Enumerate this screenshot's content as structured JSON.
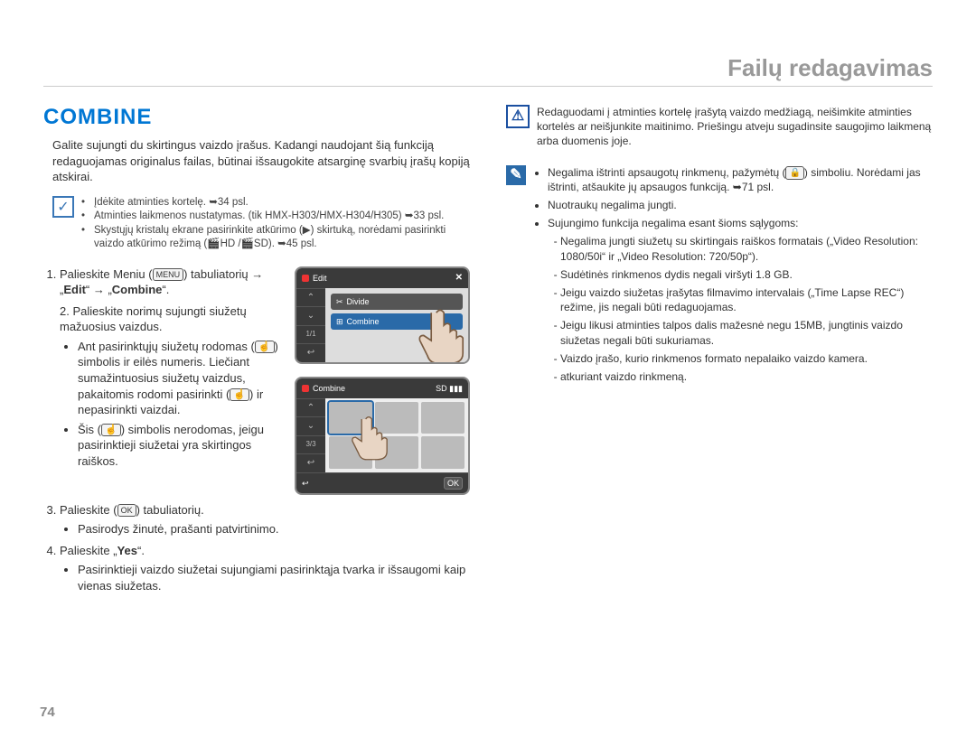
{
  "header": {
    "title": "Failų redagavimas"
  },
  "page_number": "74",
  "left": {
    "section_title": "COMBINE",
    "intro": "Galite sujungti du skirtingus vaizdo įrašus. Kadangi naudojant šią funkciją redaguojamas originalus failas, būtinai išsaugokite atsarginę svarbių įrašų kopiją atskirai.",
    "prereq": {
      "items": [
        "Įdėkite atminties kortelę. ➥34 psl.",
        "Atminties laikmenos nustatymas. (tik HMX-H303/HMX-H304/H305) ➥33 psl.",
        "Skystųjų kristalų ekrane pasirinkite atkūrimo (▶) skirtuką, norėdami pasirinkti vaizdo atkūrimo režimą (🎬HD /🎬SD). ➥45 psl."
      ]
    },
    "steps": {
      "s1a": "Palieskite Meniu (",
      "s1_menu": "MENU",
      "s1b": ") tabuliatorių → „",
      "s1_edit": "Edit",
      "s1c": "“ → „",
      "s1_combine": "Combine",
      "s1d": "“.",
      "s2": "Palieskite norimų sujungti siužetų mažuosius vaizdus.",
      "s2_sub1a": "Ant pasirinktųjų siužetų rodomas (",
      "s2_sub1b": ") simbolis ir eilės numeris. Liečiant sumažintuosius siužetų vaizdus, pakaitomis rodomi pasirinkti (",
      "s2_sub1c": ") ir nepasirinkti vaizdai.",
      "s2_sub2a": "Šis (",
      "s2_sub2b": ") simbolis nerodomas, jeigu pasirinktieji siužetai yra skirtingos raiškos.",
      "s3a": "Palieskite (",
      "s3_ok": "OK",
      "s3b": ") tabuliatorių.",
      "s3_sub": "Pasirodys žinutė, prašanti patvirtinimo.",
      "s4a": "Palieskite „",
      "s4_yes": "Yes",
      "s4b": "“.",
      "s4_sub": "Pasirinktieji vaizdo siužetai sujungiami pasirinktąja tvarka ir išsaugomi kaip vienas siužetas."
    },
    "screenshots": {
      "edit_label": "Edit",
      "divide_label": "Divide",
      "combine_label": "Combine",
      "ok_label": "OK",
      "page_indicator": "3/3"
    }
  },
  "right": {
    "warning": "Redaguodami į atminties kortelę įrašytą vaizdo medžiagą, neišimkite atminties kortelės ar neišjunkite maitinimo. Priešingu atveju sugadinsite saugojimo laikmeną arba duomenis joje.",
    "notes": {
      "n1a": "Negalima ištrinti apsaugotų rinkmenų, pažymėtų (",
      "n1b": ") simboliu. Norėdami jas ištrinti, atšaukite jų apsaugos funkciją. ➥71 psl.",
      "n2": "Nuotraukų negalima jungti.",
      "n3": "Sujungimo funkcija negalima esant šioms sąlygoms:",
      "n3_sub": [
        "Negalima jungti siužetų su skirtingais raiškos formatais („Video Resolution: 1080/50i“ ir „Video Resolution: 720/50p“).",
        "Sudėtinės rinkmenos dydis negali viršyti 1.8 GB.",
        "Jeigu vaizdo siužetas įrašytas filmavimo intervalais („Time Lapse REC“) režime, jis negali būti redaguojamas.",
        "Jeigu likusi atminties talpos dalis mažesnė negu 15MB, jungtinis vaizdo siužetas negali būti sukuriamas.",
        "Vaizdo įrašo, kurio rinkmenos formato nepalaiko vaizdo kamera.",
        "atkuriant vaizdo rinkmeną."
      ]
    }
  }
}
